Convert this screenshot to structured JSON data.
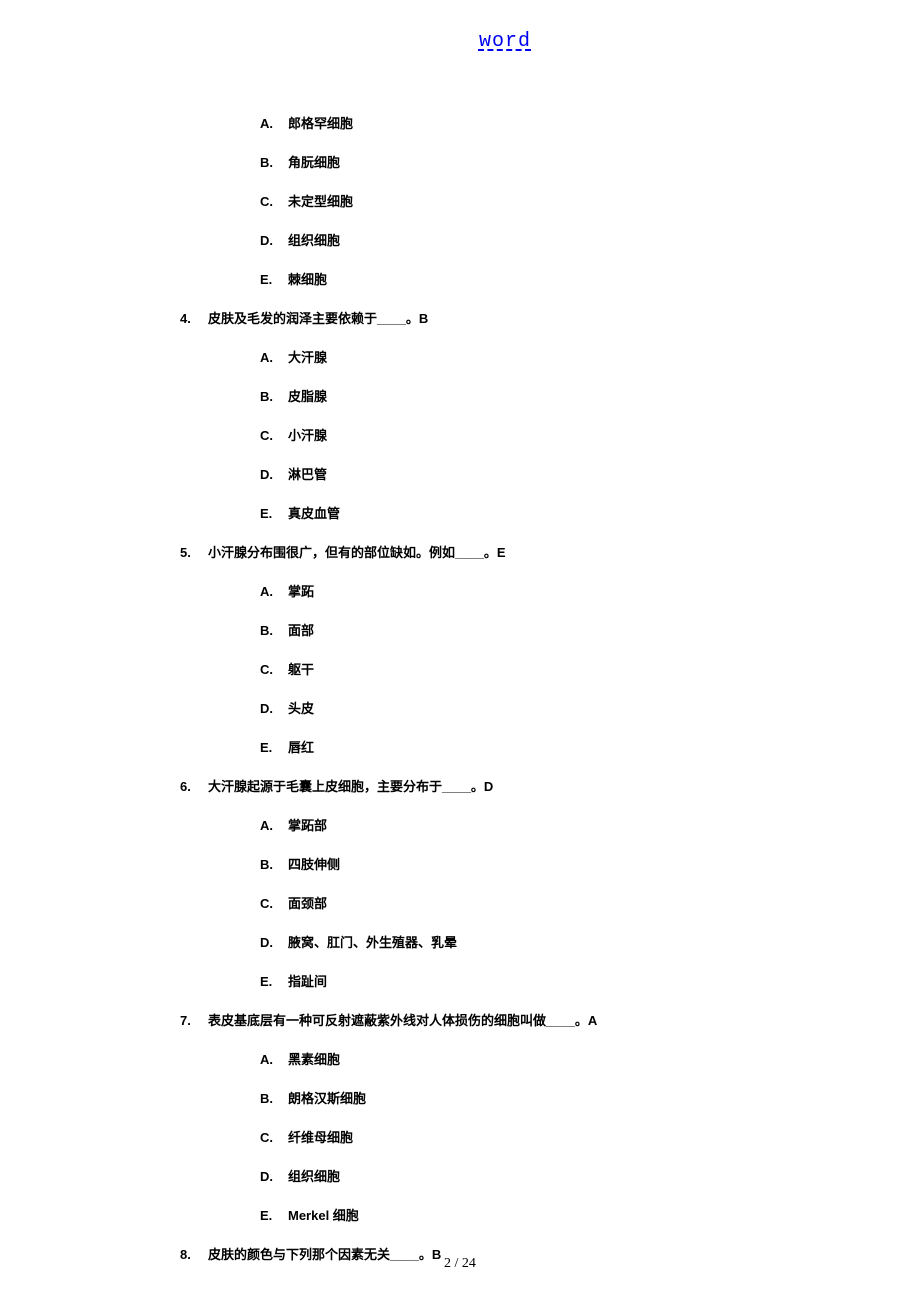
{
  "header": {
    "link_text": "word"
  },
  "q3_continued": {
    "options": {
      "A": "郎格罕细胞",
      "B": "角朊细胞",
      "C": "未定型细胞",
      "D": "组织细胞",
      "E": "棘细胞"
    }
  },
  "questions": [
    {
      "num": "4.",
      "text": "皮肤及毛发的润泽主要依赖于____。",
      "answer": "B",
      "options": {
        "A": "大汗腺",
        "B": "皮脂腺",
        "C": "小汗腺",
        "D": "淋巴管",
        "E": "真皮血管"
      }
    },
    {
      "num": "5.",
      "text": "小汗腺分布围很广，但有的部位缺如。例如____。",
      "answer": "E",
      "options": {
        "A": "掌跖",
        "B": "面部",
        "C": "躯干",
        "D": "头皮",
        "E": "唇红"
      }
    },
    {
      "num": "6.",
      "text": "大汗腺起源于毛囊上皮细胞，主要分布于____。",
      "answer": "D",
      "options": {
        "A": "掌跖部",
        "B": "四肢伸侧",
        "C": "面颈部",
        "D": "腋窝、肛门、外生殖器、乳晕",
        "E": "指趾间"
      }
    },
    {
      "num": "7.",
      "text": "表皮基底层有一种可反射遮蔽紫外线对人体损伤的细胞叫做____。",
      "answer": "A",
      "options": {
        "A": "黑素细胞",
        "B": "朗格汉斯细胞",
        "C": "纤维母细胞",
        "D": "组织细胞",
        "E": "Merkel 细胞"
      }
    },
    {
      "num": "8.",
      "text": "皮肤的颜色与下列那个因素无关____。",
      "answer": "B"
    }
  ],
  "footer": {
    "page": "2 / 24"
  }
}
